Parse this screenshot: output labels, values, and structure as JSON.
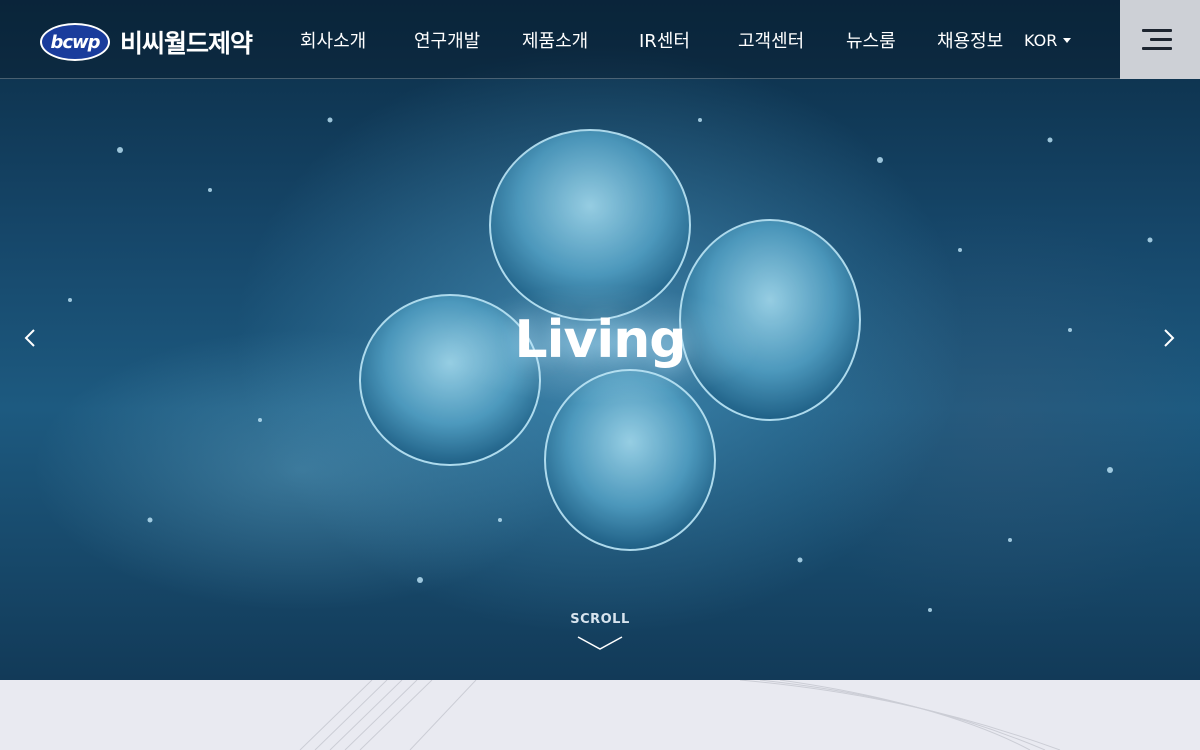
{
  "brand": {
    "logo_mark": "bcwp",
    "logo_text": "비씨월드제약"
  },
  "nav": {
    "items": [
      {
        "label": "회사소개"
      },
      {
        "label": "연구개발"
      },
      {
        "label": "제품소개"
      },
      {
        "label": "IR센터"
      },
      {
        "label": "고객센터"
      },
      {
        "label": "뉴스룸"
      },
      {
        "label": "채용정보"
      }
    ],
    "language": "KOR"
  },
  "hero": {
    "title": "Living",
    "scroll_label": "SCROLL",
    "prev_icon": "chevron-left-icon",
    "next_icon": "chevron-right-icon"
  },
  "icons": {
    "menu": "hamburger-menu-icon",
    "language_caret": "caret-down-icon",
    "scroll": "chevron-down-icon"
  },
  "colors": {
    "logo_blue": "#1a3c9c",
    "menu_button_bg": "#cdd0d6",
    "lower_section_bg": "#e9eaf1"
  }
}
